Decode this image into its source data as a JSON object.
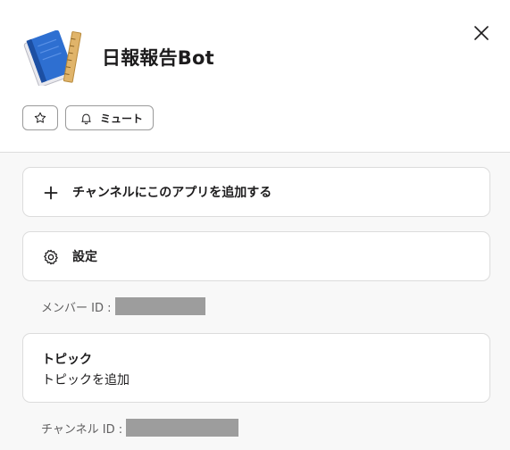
{
  "app": {
    "title": "日報報告Bot",
    "icon": "notebook-with-ruler-icon"
  },
  "header": {
    "close_icon": "close-icon",
    "buttons": {
      "star_icon": "star-outline-icon",
      "mute_icon": "bell-icon",
      "mute_label": "ミュート"
    }
  },
  "actions": {
    "add_to_channel": {
      "icon": "plus-icon",
      "label": "チャンネルにこのアプリを追加する"
    },
    "settings": {
      "icon": "gear-icon",
      "label": "設定"
    }
  },
  "member_id": {
    "label": "メンバー ID :"
  },
  "topic": {
    "title": "トピック",
    "add_label": "トピックを追加"
  },
  "channel_id": {
    "label": "チャンネル ID :"
  },
  "colors": {
    "text": "#1d1c1d",
    "muted_text": "#616061",
    "panel_bg": "#f8f8f8",
    "border": "#dcdcdc",
    "redaction": "#9d9d9d",
    "icon_blue": "#2e6fd1",
    "ruler": "#e0b46a"
  }
}
